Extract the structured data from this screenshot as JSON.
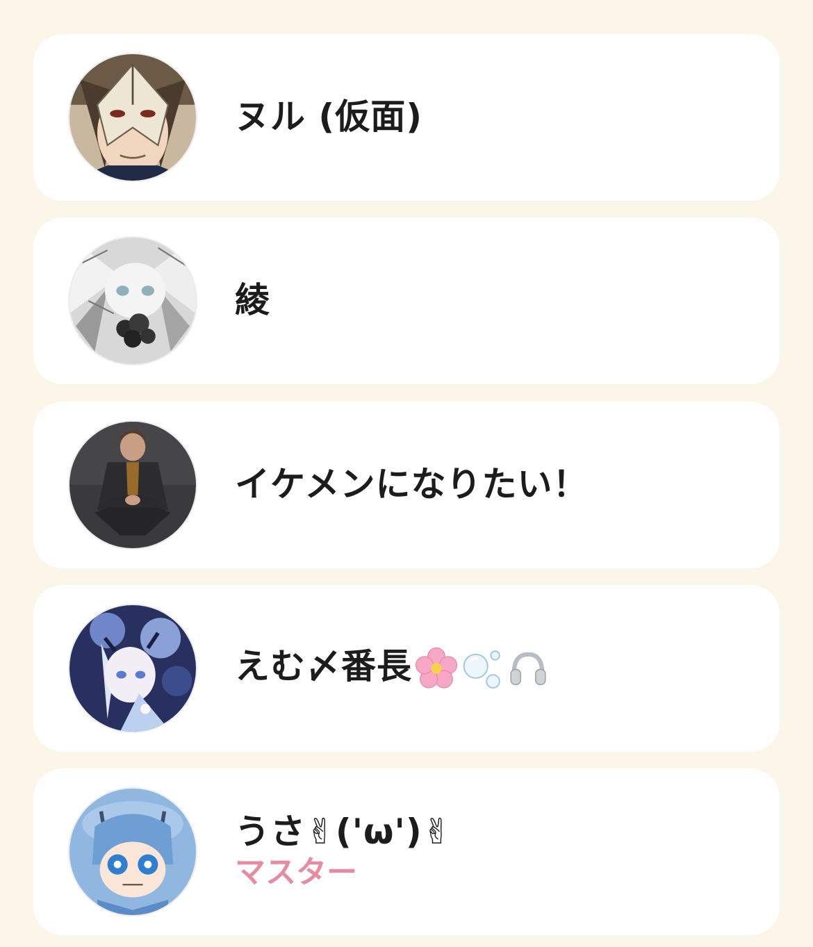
{
  "members": [
    {
      "name": "ヌル (仮面)",
      "avatar": "masked-anime-character-avatar"
    },
    {
      "name": "綾",
      "avatar": "monochrome-anime-girl-avatar"
    },
    {
      "name": "イケメンになりたい！",
      "avatar": "man-in-suit-photo-avatar"
    },
    {
      "name": "えむ〆番長",
      "avatar": "blue-anime-girl-avatar",
      "emojis": [
        "cherry-blossom-icon",
        "bubbles-icon",
        "headphones-icon"
      ]
    },
    {
      "name": "うさ✌('ω')✌",
      "avatar": "blue-chibi-character-avatar",
      "role": "マスター"
    }
  ],
  "colors": {
    "background": "#fcf6e8",
    "card": "#ffffff",
    "role_text": "#e88aa0",
    "name_text": "#1c1c1c"
  }
}
